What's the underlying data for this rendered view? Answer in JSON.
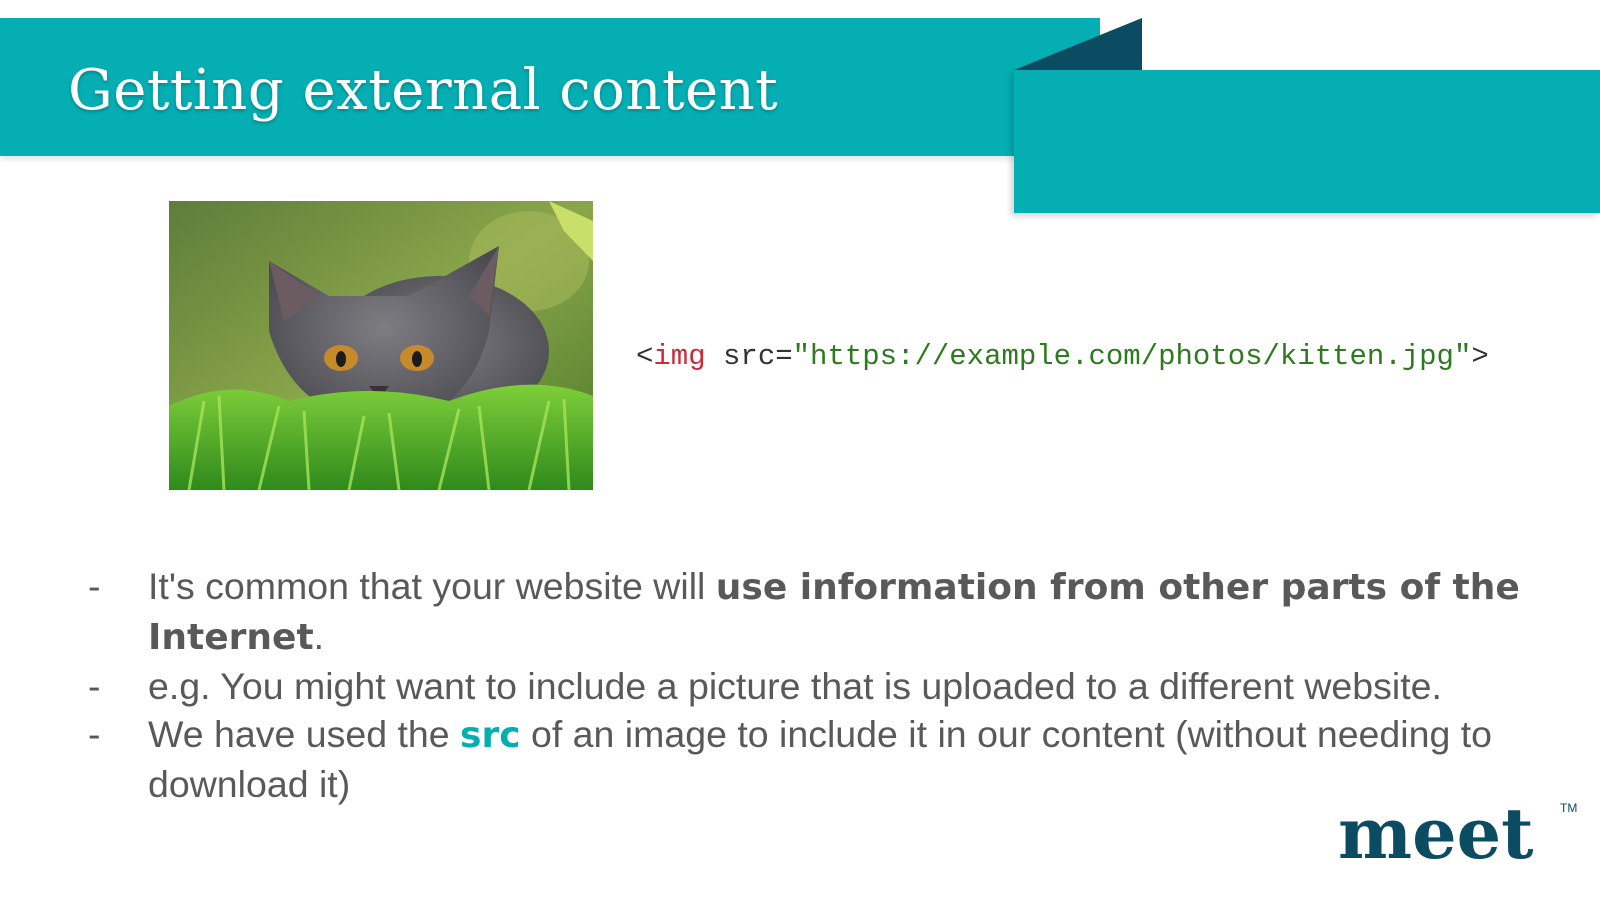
{
  "slide": {
    "title": "Getting external content"
  },
  "image": {
    "alt": "kitten in grass",
    "icon": "kitten-photo"
  },
  "code": {
    "open": "<",
    "tag": "img",
    "attr": " src=",
    "value": "\"https://example.com/photos/kitten.jpg\"",
    "close": ">"
  },
  "bullets": [
    {
      "dash": "-",
      "pre": "It's common that your website will ",
      "bold": "use information from other parts of the Internet",
      "post": "."
    },
    {
      "dash": "-",
      "text": "e.g. You might want to include a picture that is uploaded to a different website."
    },
    {
      "dash": "-",
      "pre": "We have used the ",
      "accent": "src",
      "post": " of an image to include it in our content (without needing to download it)"
    }
  ],
  "logo": {
    "text": "meet",
    "tm": "TM"
  },
  "colors": {
    "teal": "#05aeb3",
    "navy": "#0b4c63",
    "body_text": "#595959",
    "code_tag": "#cc2b3a",
    "code_string": "#2f7a1f"
  }
}
